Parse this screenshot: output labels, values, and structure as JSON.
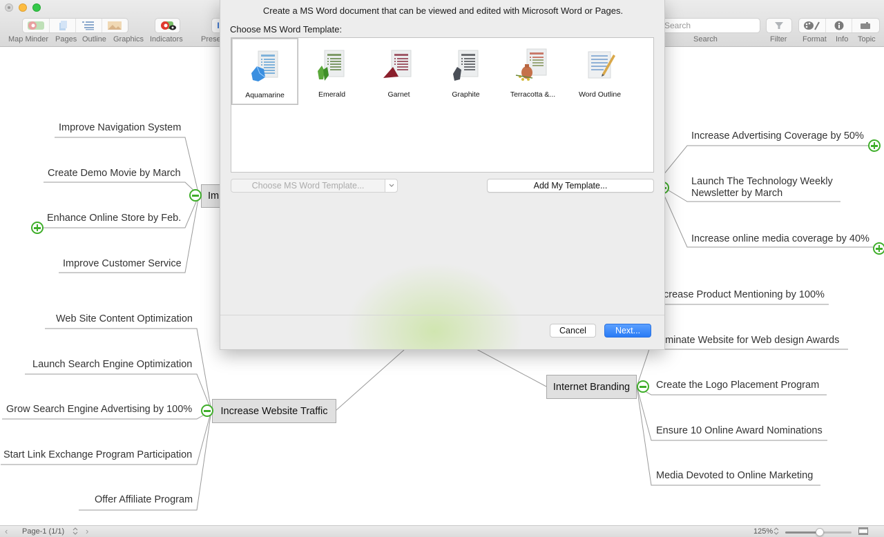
{
  "toolbar": {
    "items": [
      {
        "label": "Map Minder",
        "icon": "map-minder-icon"
      },
      {
        "label": "Pages",
        "icon": "pages-icon"
      },
      {
        "label": "Outline",
        "icon": "outline-icon"
      },
      {
        "label": "Graphics",
        "icon": "graphics-icon"
      },
      {
        "label": "Indicators",
        "icon": "indicators-icon"
      },
      {
        "label": "Prese",
        "icon": "presentation-icon"
      },
      {
        "label": "Search",
        "icon": "search-icon"
      },
      {
        "label": "Filter",
        "icon": "filter-icon"
      },
      {
        "label": "Format",
        "icon": "palette-icon"
      },
      {
        "label": "Info",
        "icon": "info-icon"
      },
      {
        "label": "Topic",
        "icon": "topic-icon"
      }
    ],
    "search_placeholder": "Search"
  },
  "dialog": {
    "description": "Create a MS Word document that can be viewed and edited with Microsoft Word or Pages.",
    "choose_label": "Choose MS Word Template:",
    "templates": [
      {
        "name": "Aquamarine",
        "selected": true,
        "color": "#3b8fe0"
      },
      {
        "name": "Emerald",
        "selected": false,
        "color": "#5aa83a"
      },
      {
        "name": "Garnet",
        "selected": false,
        "color": "#8a1f2c"
      },
      {
        "name": "Graphite",
        "selected": false,
        "color": "#4a4f57"
      },
      {
        "name": "Terracotta &...",
        "selected": false,
        "color": "#c5714a"
      },
      {
        "name": "Word Outline",
        "selected": false,
        "color": "#7fa4cf"
      }
    ],
    "template_select": "Choose MS Word Template...",
    "add_template": "Add My Template...",
    "cancel": "Cancel",
    "next": "Next..."
  },
  "mindmap": {
    "topics": [
      {
        "label": "Improve Navigation System"
      },
      {
        "label": "Create Demo Movie by March"
      },
      {
        "label": "Enhance Online Store by Feb."
      },
      {
        "label": "Improve Customer Service"
      },
      {
        "label": "Imp"
      },
      {
        "label": "Web Site Content Optimization"
      },
      {
        "label": "Launch Search Engine Optimization"
      },
      {
        "label": "Grow Search Engine Advertising by 100%"
      },
      {
        "label": "Start Link Exchange Program Participation"
      },
      {
        "label": "Offer Affiliate Program"
      },
      {
        "label": "Increase Website Traffic"
      },
      {
        "label": "Increase Advertising Coverage by 50%"
      },
      {
        "label": "Launch The Technology Weekly"
      },
      {
        "label": "Newsletter by March"
      },
      {
        "label": "Increase online media coverage by 40%"
      },
      {
        "label": "crease Product Mentioning by 100%"
      },
      {
        "label": "ominate Website for Web design Awards"
      },
      {
        "label": "Internet Branding"
      },
      {
        "label": "Create the Logo Placement Program"
      },
      {
        "label": "Ensure 10 Online Award Nominations"
      },
      {
        "label": "Media Devoted to Online Marketing"
      }
    ]
  },
  "statusbar": {
    "page": "Page-1 (1/1)",
    "zoom": "125%",
    "zoom_slider_fraction": 0.52
  }
}
